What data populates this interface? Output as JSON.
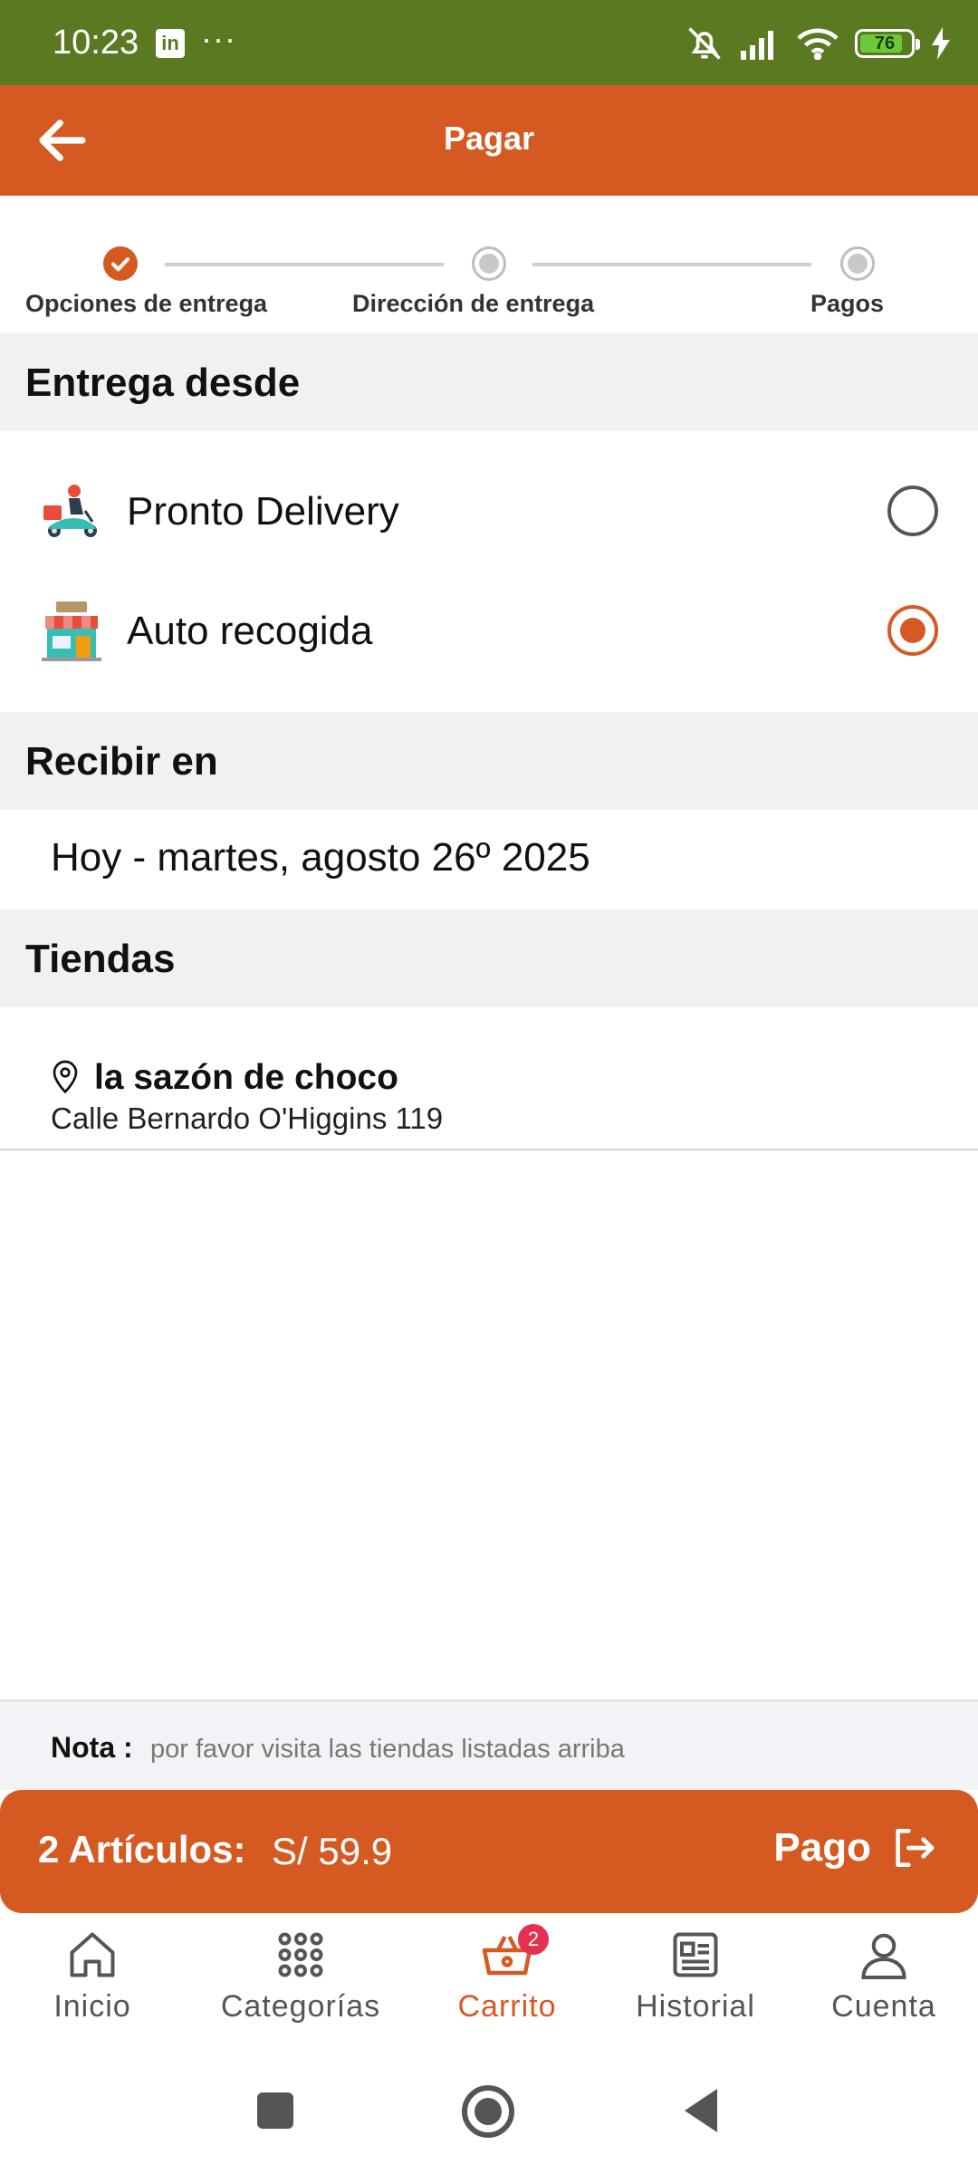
{
  "status_bar": {
    "time": "10:23",
    "linkedin_glyph": "in",
    "more": "···",
    "battery": "76"
  },
  "header": {
    "title": "Pagar",
    "back_icon": "arrow-left-icon"
  },
  "stepper": {
    "steps": [
      {
        "label": "Opciones de entrega",
        "state": "done"
      },
      {
        "label": "Dirección de entrega",
        "state": "todo"
      },
      {
        "label": "Pagos",
        "state": "todo"
      }
    ]
  },
  "delivery_section": {
    "title": "Entrega desde",
    "options": [
      {
        "label": "Pronto Delivery",
        "icon": "delivery-scooter-icon",
        "selected": false
      },
      {
        "label": "Auto recogida",
        "icon": "store-icon",
        "selected": true
      }
    ]
  },
  "receive_section": {
    "title": "Recibir en",
    "date": "Hoy - martes, agosto 26º 2025"
  },
  "stores_section": {
    "title": "Tiendas",
    "stores": [
      {
        "name": "la sazón de choco",
        "address": "Calle Bernardo O'Higgins 119"
      }
    ]
  },
  "note": {
    "label": "Nota :",
    "text": "por favor visita las tiendas listadas arriba"
  },
  "checkout": {
    "items_label": "2 Artículos:",
    "price": "S/ 59.9",
    "pay_label": "Pago"
  },
  "bottom_nav": {
    "items": [
      {
        "label": "Inicio",
        "icon": "home-icon"
      },
      {
        "label": "Categorías",
        "icon": "grid-icon"
      },
      {
        "label": "Carrito",
        "icon": "basket-icon",
        "badge": "2",
        "active": true
      },
      {
        "label": "Historial",
        "icon": "news-icon"
      },
      {
        "label": "Cuenta",
        "icon": "user-icon"
      }
    ]
  },
  "colors": {
    "status_bar": "#5a7a22",
    "brand": "#d55a22",
    "badge": "#e53050"
  }
}
